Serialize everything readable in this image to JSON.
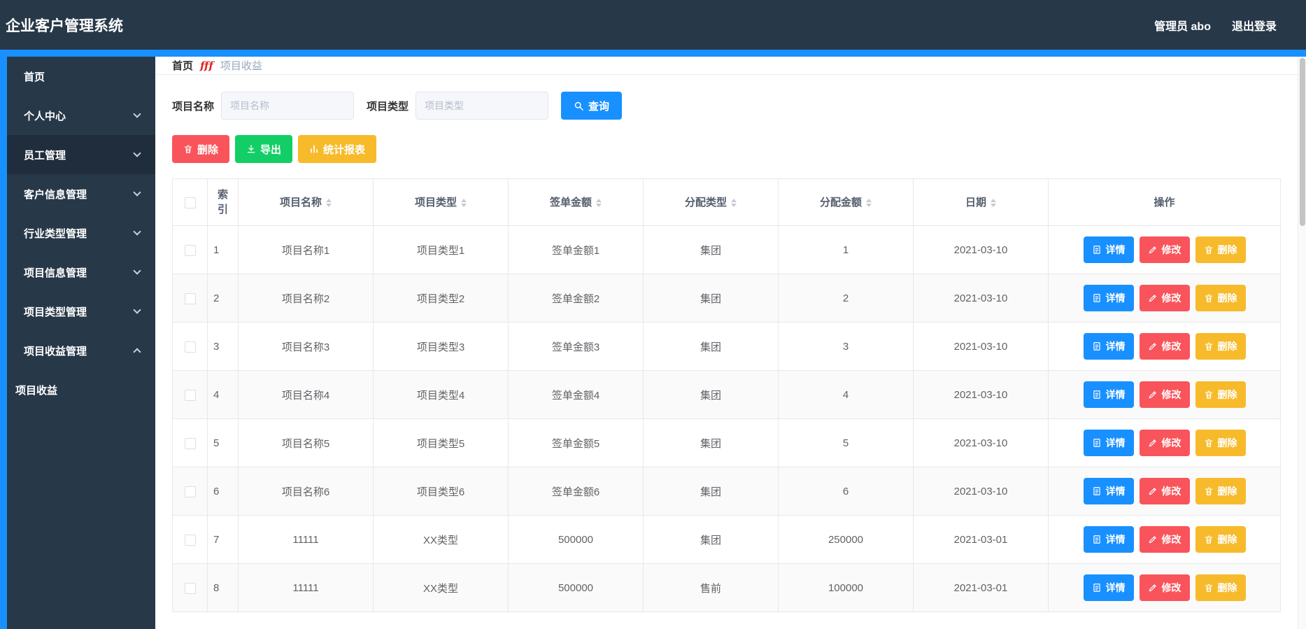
{
  "colors": {
    "accent_blue": "#1890ff",
    "danger_red": "#f9545b",
    "success_green": "#13ce66",
    "warning_yellow": "#f7ba2a",
    "nav_dark": "#273849"
  },
  "header": {
    "title": "企业客户管理系统",
    "user": "管理员 abo",
    "logout": "退出登录"
  },
  "sidebar": {
    "items": [
      {
        "label": "首页",
        "chevron": "none",
        "active": false
      },
      {
        "label": "个人中心",
        "chevron": "down",
        "active": false
      },
      {
        "label": "员工管理",
        "chevron": "down",
        "active": true
      },
      {
        "label": "客户信息管理",
        "chevron": "down",
        "active": false
      },
      {
        "label": "行业类型管理",
        "chevron": "down",
        "active": false
      },
      {
        "label": "项目信息管理",
        "chevron": "down",
        "active": false
      },
      {
        "label": "项目类型管理",
        "chevron": "down",
        "active": false
      },
      {
        "label": "项目收益管理",
        "chevron": "up",
        "active": false
      }
    ],
    "subitem": {
      "label": "项目收益"
    }
  },
  "breadcrumb": {
    "home": "首页",
    "separator": "fff",
    "current": "项目收益"
  },
  "filters": {
    "name_label": "项目名称",
    "name_placeholder": "项目名称",
    "type_label": "项目类型",
    "type_placeholder": "项目类型",
    "search_label": "查询"
  },
  "toolbar": {
    "delete_label": "删除",
    "export_label": "导出",
    "report_label": "统计报表"
  },
  "table": {
    "columns": [
      {
        "label": "索引",
        "sortable": false
      },
      {
        "label": "项目名称",
        "sortable": true
      },
      {
        "label": "项目类型",
        "sortable": true
      },
      {
        "label": "签单金额",
        "sortable": true
      },
      {
        "label": "分配类型",
        "sortable": true
      },
      {
        "label": "分配金额",
        "sortable": true
      },
      {
        "label": "日期",
        "sortable": true
      },
      {
        "label": "操作",
        "sortable": false
      }
    ],
    "actions": {
      "detail": "详情",
      "edit": "修改",
      "delete": "删除"
    },
    "rows": [
      {
        "index": "1",
        "name": "项目名称1",
        "type": "项目类型1",
        "sign_amount": "签单金额1",
        "alloc_type": "集团",
        "alloc_amount": "1",
        "date": "2021-03-10"
      },
      {
        "index": "2",
        "name": "项目名称2",
        "type": "项目类型2",
        "sign_amount": "签单金额2",
        "alloc_type": "集团",
        "alloc_amount": "2",
        "date": "2021-03-10"
      },
      {
        "index": "3",
        "name": "项目名称3",
        "type": "项目类型3",
        "sign_amount": "签单金额3",
        "alloc_type": "集团",
        "alloc_amount": "3",
        "date": "2021-03-10"
      },
      {
        "index": "4",
        "name": "项目名称4",
        "type": "项目类型4",
        "sign_amount": "签单金额4",
        "alloc_type": "集团",
        "alloc_amount": "4",
        "date": "2021-03-10"
      },
      {
        "index": "5",
        "name": "项目名称5",
        "type": "项目类型5",
        "sign_amount": "签单金额5",
        "alloc_type": "集团",
        "alloc_amount": "5",
        "date": "2021-03-10"
      },
      {
        "index": "6",
        "name": "项目名称6",
        "type": "项目类型6",
        "sign_amount": "签单金额6",
        "alloc_type": "集团",
        "alloc_amount": "6",
        "date": "2021-03-10"
      },
      {
        "index": "7",
        "name": "11111",
        "type": "XX类型",
        "sign_amount": "500000",
        "alloc_type": "集团",
        "alloc_amount": "250000",
        "date": "2021-03-01"
      },
      {
        "index": "8",
        "name": "11111",
        "type": "XX类型",
        "sign_amount": "500000",
        "alloc_type": "售前",
        "alloc_amount": "100000",
        "date": "2021-03-01"
      }
    ]
  }
}
